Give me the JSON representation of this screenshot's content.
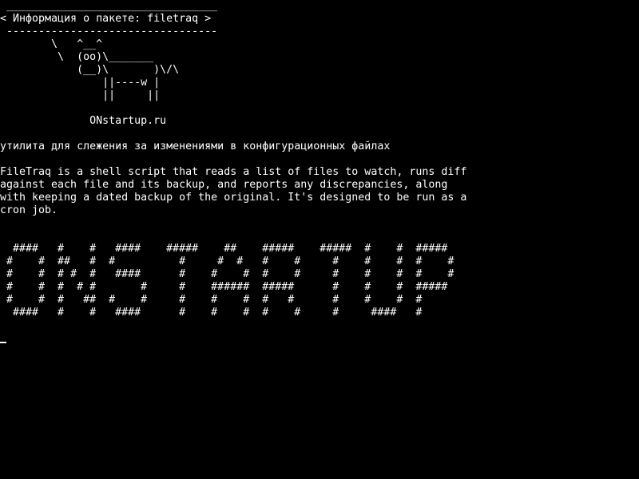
{
  "terminal": {
    "background": "#000000",
    "foreground": "#ffffff",
    "cowsay_bubble": [
      " _________________________________",
      "< Информация о пакете: filetraq >",
      " ---------------------------------"
    ],
    "cow_art": [
      "        \\   ^__^",
      "         \\  (oo)\\_______",
      "            (__)\\       )\\/\\",
      "                ||----w |",
      "                ||     ||"
    ],
    "site_line": "              ONstartup.ru",
    "description_ru": "утилита для слежения за изменениями в конфигурационных файлах",
    "description_en": [
      "FileTraq is a shell script that reads a list of files to watch, runs diff",
      "against each file and its backup, and reports any discrepancies, along",
      "with keeping a dated backup of the original. It's designed to be run as a",
      "cron job."
    ],
    "banner_art": [
      "  ####   #    #   ####    #####    ##    #####    #####  #    #  #####",
      " #    #  ##   #  #          #     #  #   #    #     #    #    #  #    #",
      " #    #  # #  #   ####      #    #    #  #    #     #    #    #  #    #",
      " #    #  #  # #       #     #    ######  #####      #    #    #  #####",
      " #    #  #   ##  #    #     #    #    #  #   #      #    #    #  #",
      "  ####   #    #   ####      #    #    #  #    #     #     ####   #"
    ]
  }
}
